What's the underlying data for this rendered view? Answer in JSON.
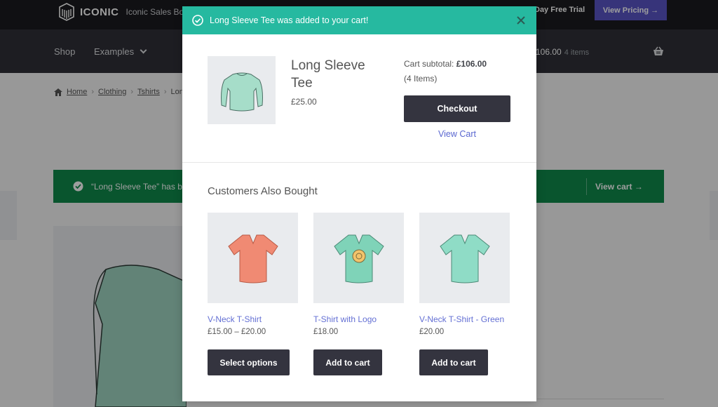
{
  "topbar": {
    "logo_text": "ICONIC",
    "logo_sub": "Iconic Sales Boos",
    "trial_text": "Day Free Trial",
    "pricing_label": "View Pricing →"
  },
  "nav": {
    "shop": "Shop",
    "examples": "Examples",
    "cart_total": "106.00",
    "cart_count": "4 items"
  },
  "breadcrumb": {
    "home": "Home",
    "clothing": "Clothing",
    "tshirts": "Tshirts",
    "current": "Long"
  },
  "notice": {
    "text": "“Long Sleeve Tee” has b",
    "view_cart": "View cart"
  },
  "modal": {
    "header_text": "Long Sleeve Tee was added to your cart!",
    "product_name": "Long Sleeve Tee",
    "product_price": "£25.00",
    "subtotal_label": "Cart subtotal:",
    "subtotal_value": "£106.00",
    "items_count": "(4 Items)",
    "checkout_label": "Checkout",
    "view_cart_label": "View Cart",
    "section_title": "Customers Also Bought",
    "products": [
      {
        "name": "V-Neck T-Shirt",
        "price": "£15.00 – £20.00",
        "button": "Select options",
        "shirt_color": "#f08a73",
        "logo": false
      },
      {
        "name": "T-Shirt with Logo",
        "price": "£18.00",
        "button": "Add to cart",
        "shirt_color": "#7fd3b8",
        "logo": true
      },
      {
        "name": "V-Neck T-Shirt - Green",
        "price": "£20.00",
        "button": "Add to cart",
        "shirt_color": "#8fdcc6",
        "logo": false
      }
    ]
  },
  "colors": {
    "header_teal": "#26b9a0",
    "button_dark": "#34343f",
    "link_blue": "#5a67d0",
    "notice_green": "#0f8a4b",
    "pricing_purple": "#5a54c6"
  }
}
